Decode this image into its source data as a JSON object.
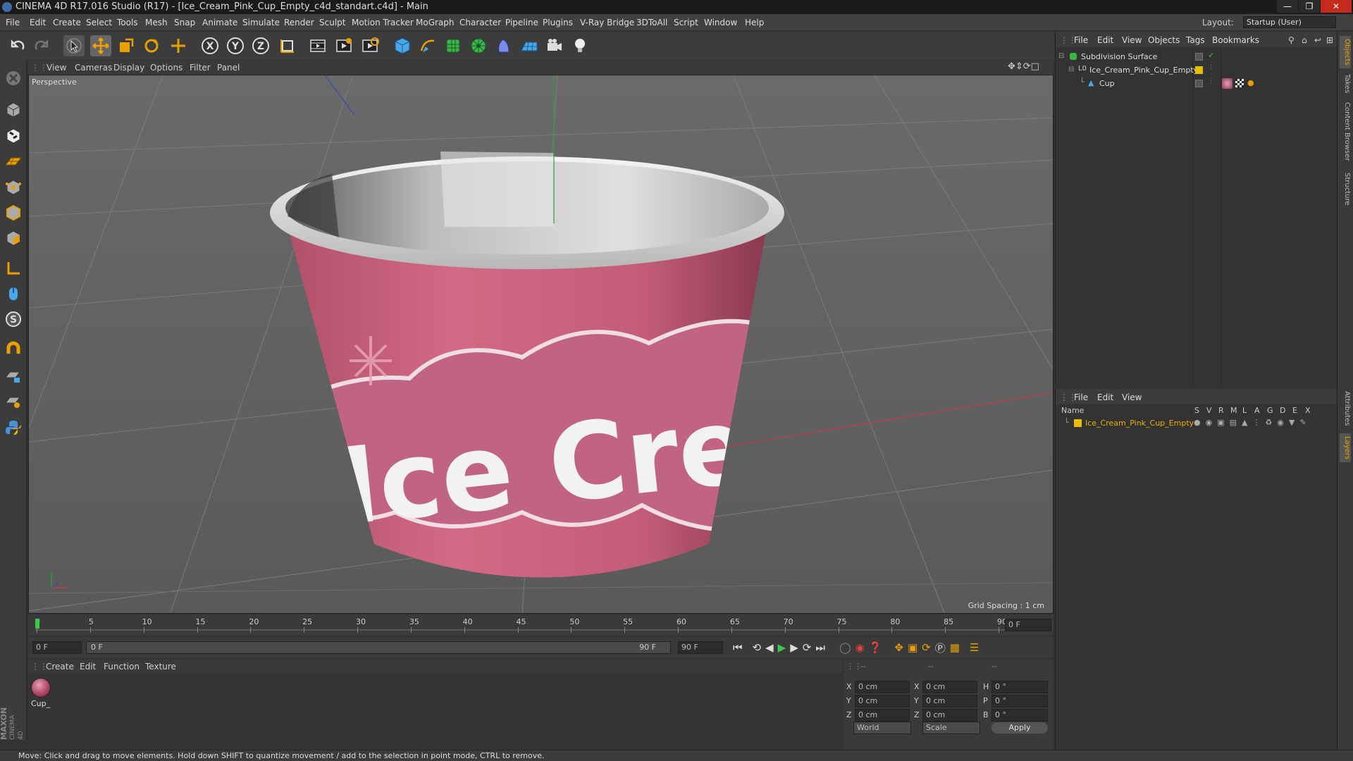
{
  "window": {
    "title": "CINEMA 4D R17.016 Studio (R17) - [Ice_Cream_Pink_Cup_Empty_c4d_standart.c4d] - Main"
  },
  "menubar": [
    "File",
    "Edit",
    "Create",
    "Select",
    "Tools",
    "Mesh",
    "Snap",
    "Animate",
    "Simulate",
    "Render",
    "Sculpt",
    "Motion Tracker",
    "MoGraph",
    "Character",
    "Pipeline",
    "Plugins",
    "V-Ray Bridge",
    "3DToAll",
    "Script",
    "Window",
    "Help"
  ],
  "layout": {
    "label": "Layout:",
    "value": "Startup (User)"
  },
  "viewport": {
    "menu": [
      "View",
      "Cameras",
      "Display",
      "Options",
      "Filter",
      "Panel"
    ],
    "label": "Perspective",
    "grid_spacing": "Grid Spacing : 1 cm",
    "cup_text": "Ice Cre"
  },
  "timeline": {
    "ticks": [
      "0",
      "5",
      "10",
      "15",
      "20",
      "25",
      "30",
      "35",
      "40",
      "45",
      "50",
      "55",
      "60",
      "65",
      "70",
      "75",
      "80",
      "85",
      "90"
    ],
    "current_frame": "0 F",
    "start_field": "0 F",
    "range_start": "0 F",
    "range_end": "90 F",
    "end_field": "90 F"
  },
  "material_panel": {
    "menu": [
      "Create",
      "Edit",
      "Function",
      "Texture"
    ],
    "material_name": "Cup_"
  },
  "coord_panel": {
    "headers": [
      "--",
      "--",
      "--"
    ],
    "rows": [
      {
        "a": "X",
        "v1": "0 cm",
        "b": "X",
        "v2": "0 cm",
        "c": "H",
        "v3": "0 °"
      },
      {
        "a": "Y",
        "v1": "0 cm",
        "b": "Y",
        "v2": "0 cm",
        "c": "P",
        "v3": "0 °"
      },
      {
        "a": "Z",
        "v1": "0 cm",
        "b": "Z",
        "v2": "0 cm",
        "c": "B",
        "v3": "0 °"
      }
    ],
    "world": "World",
    "scale": "Scale",
    "apply": "Apply"
  },
  "object_manager": {
    "menu": [
      "File",
      "Edit",
      "View",
      "Objects",
      "Tags",
      "Bookmarks"
    ],
    "objects": [
      {
        "name": "Subdivision Surface",
        "indent": 0
      },
      {
        "name": "Ice_Cream_Pink_Cup_Empty",
        "indent": 1
      },
      {
        "name": "Cup",
        "indent": 2
      }
    ]
  },
  "layer_manager": {
    "menu": [
      "File",
      "Edit",
      "View"
    ],
    "columns": [
      "Name",
      "S",
      "V",
      "R",
      "M",
      "L",
      "A",
      "G",
      "D",
      "E",
      "X"
    ],
    "layers": [
      {
        "name": "Ice_Cream_Pink_Cup_Empty",
        "color": "#e6c000"
      }
    ]
  },
  "side_tabs": [
    "Objects",
    "Takes",
    "Content Browser",
    "Structure",
    "Attributes",
    "Layers"
  ],
  "status": "Move: Click and drag to move elements. Hold down SHIFT to quantize movement / add to the selection in point mode, CTRL to remove.",
  "brand": {
    "line1": "MAXON",
    "line2": "CINEMA 4D"
  },
  "colors": {
    "accent_orange": "#e8a000",
    "axis_x": "#c83030",
    "axis_y": "#30b030",
    "axis_z": "#3050c8",
    "cup_pink": "#c95c78"
  }
}
